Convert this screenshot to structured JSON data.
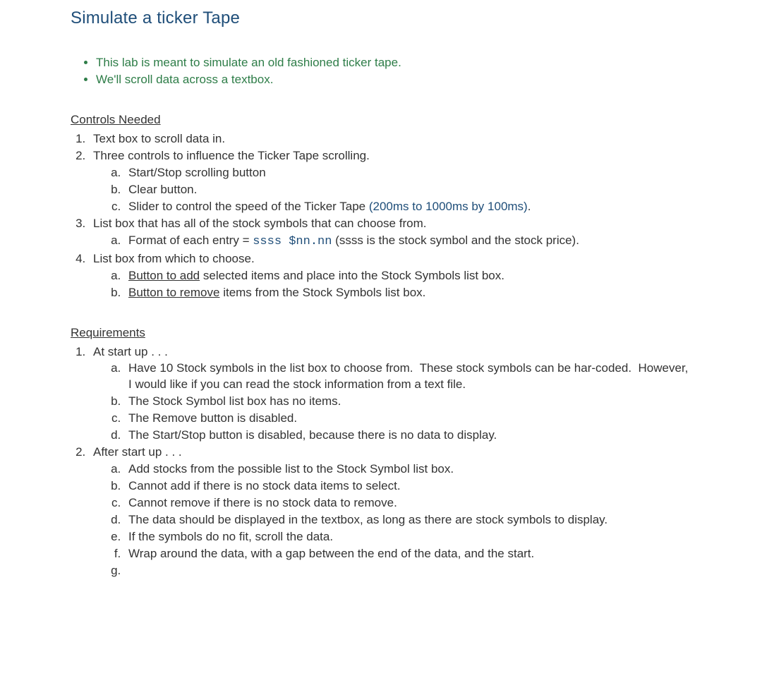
{
  "title": "Simulate a ticker Tape",
  "intro_bullets": [
    "This lab is meant to simulate an old fashioned ticker tape.",
    "We'll scroll data across a textbox."
  ],
  "controls": {
    "heading": "Controls Needed",
    "items": [
      {
        "parts": [
          {
            "text": "Text box to scroll data in."
          }
        ]
      },
      {
        "parts": [
          {
            "text": "Three controls to influence the Ticker Tape scrolling."
          }
        ],
        "sub": [
          {
            "parts": [
              {
                "text": "Start/Stop scrolling button"
              }
            ]
          },
          {
            "parts": [
              {
                "text": "Clear button."
              }
            ]
          },
          {
            "parts": [
              {
                "text": "Slider to control the speed of the Ticker Tape "
              },
              {
                "text": "(200ms to 1000ms by 100ms)",
                "cls": "blue"
              },
              {
                "text": "."
              }
            ]
          }
        ]
      },
      {
        "parts": [
          {
            "text": "List box that has all of the stock symbols that can choose from."
          }
        ],
        "sub": [
          {
            "parts": [
              {
                "text": "Format of each entry = "
              },
              {
                "text": "ssss $nn.nn",
                "cls": "code"
              },
              {
                "text": " (ssss is the stock symbol and the stock price)."
              }
            ]
          }
        ]
      },
      {
        "parts": [
          {
            "text": "List box from which to choose."
          }
        ],
        "sub": [
          {
            "parts": [
              {
                "text": "Button to add",
                "cls": "u"
              },
              {
                "text": " selected items and place into the Stock Symbols list box."
              }
            ]
          },
          {
            "parts": [
              {
                "text": "Button to remove",
                "cls": "u"
              },
              {
                "text": " items from the Stock Symbols list box."
              }
            ]
          }
        ]
      }
    ]
  },
  "requirements": {
    "heading": "Requirements",
    "items": [
      {
        "parts": [
          {
            "text": "At start up . . ."
          }
        ],
        "sub": [
          {
            "parts": [
              {
                "text": "Have 10 Stock symbols in the list box to choose from.  These stock symbols can be har-coded.  However, I would like if you can read the stock information from a text file."
              }
            ]
          },
          {
            "parts": [
              {
                "text": "The Stock Symbol list box has no items."
              }
            ]
          },
          {
            "parts": [
              {
                "text": "The Remove button is disabled."
              }
            ]
          },
          {
            "parts": [
              {
                "text": "The Start/Stop button is disabled, because there is no data to display."
              }
            ]
          }
        ]
      },
      {
        "parts": [
          {
            "text": "After start up . . ."
          }
        ],
        "sub": [
          {
            "parts": [
              {
                "text": "Add stocks from the possible list to the Stock Symbol list box."
              }
            ]
          },
          {
            "parts": [
              {
                "text": "Cannot add if there is no stock data items to select."
              }
            ]
          },
          {
            "parts": [
              {
                "text": "Cannot remove if there is no stock data to remove."
              }
            ]
          },
          {
            "parts": [
              {
                "text": "The data should be displayed in the textbox, as long as there are stock symbols to display."
              }
            ]
          },
          {
            "parts": [
              {
                "text": "If the symbols do no fit, scroll the data."
              }
            ]
          },
          {
            "parts": [
              {
                "text": "Wrap around the data, with a gap between the end of the data, and the start."
              }
            ]
          },
          {
            "parts": [
              {
                "text": ""
              }
            ]
          }
        ]
      }
    ]
  }
}
